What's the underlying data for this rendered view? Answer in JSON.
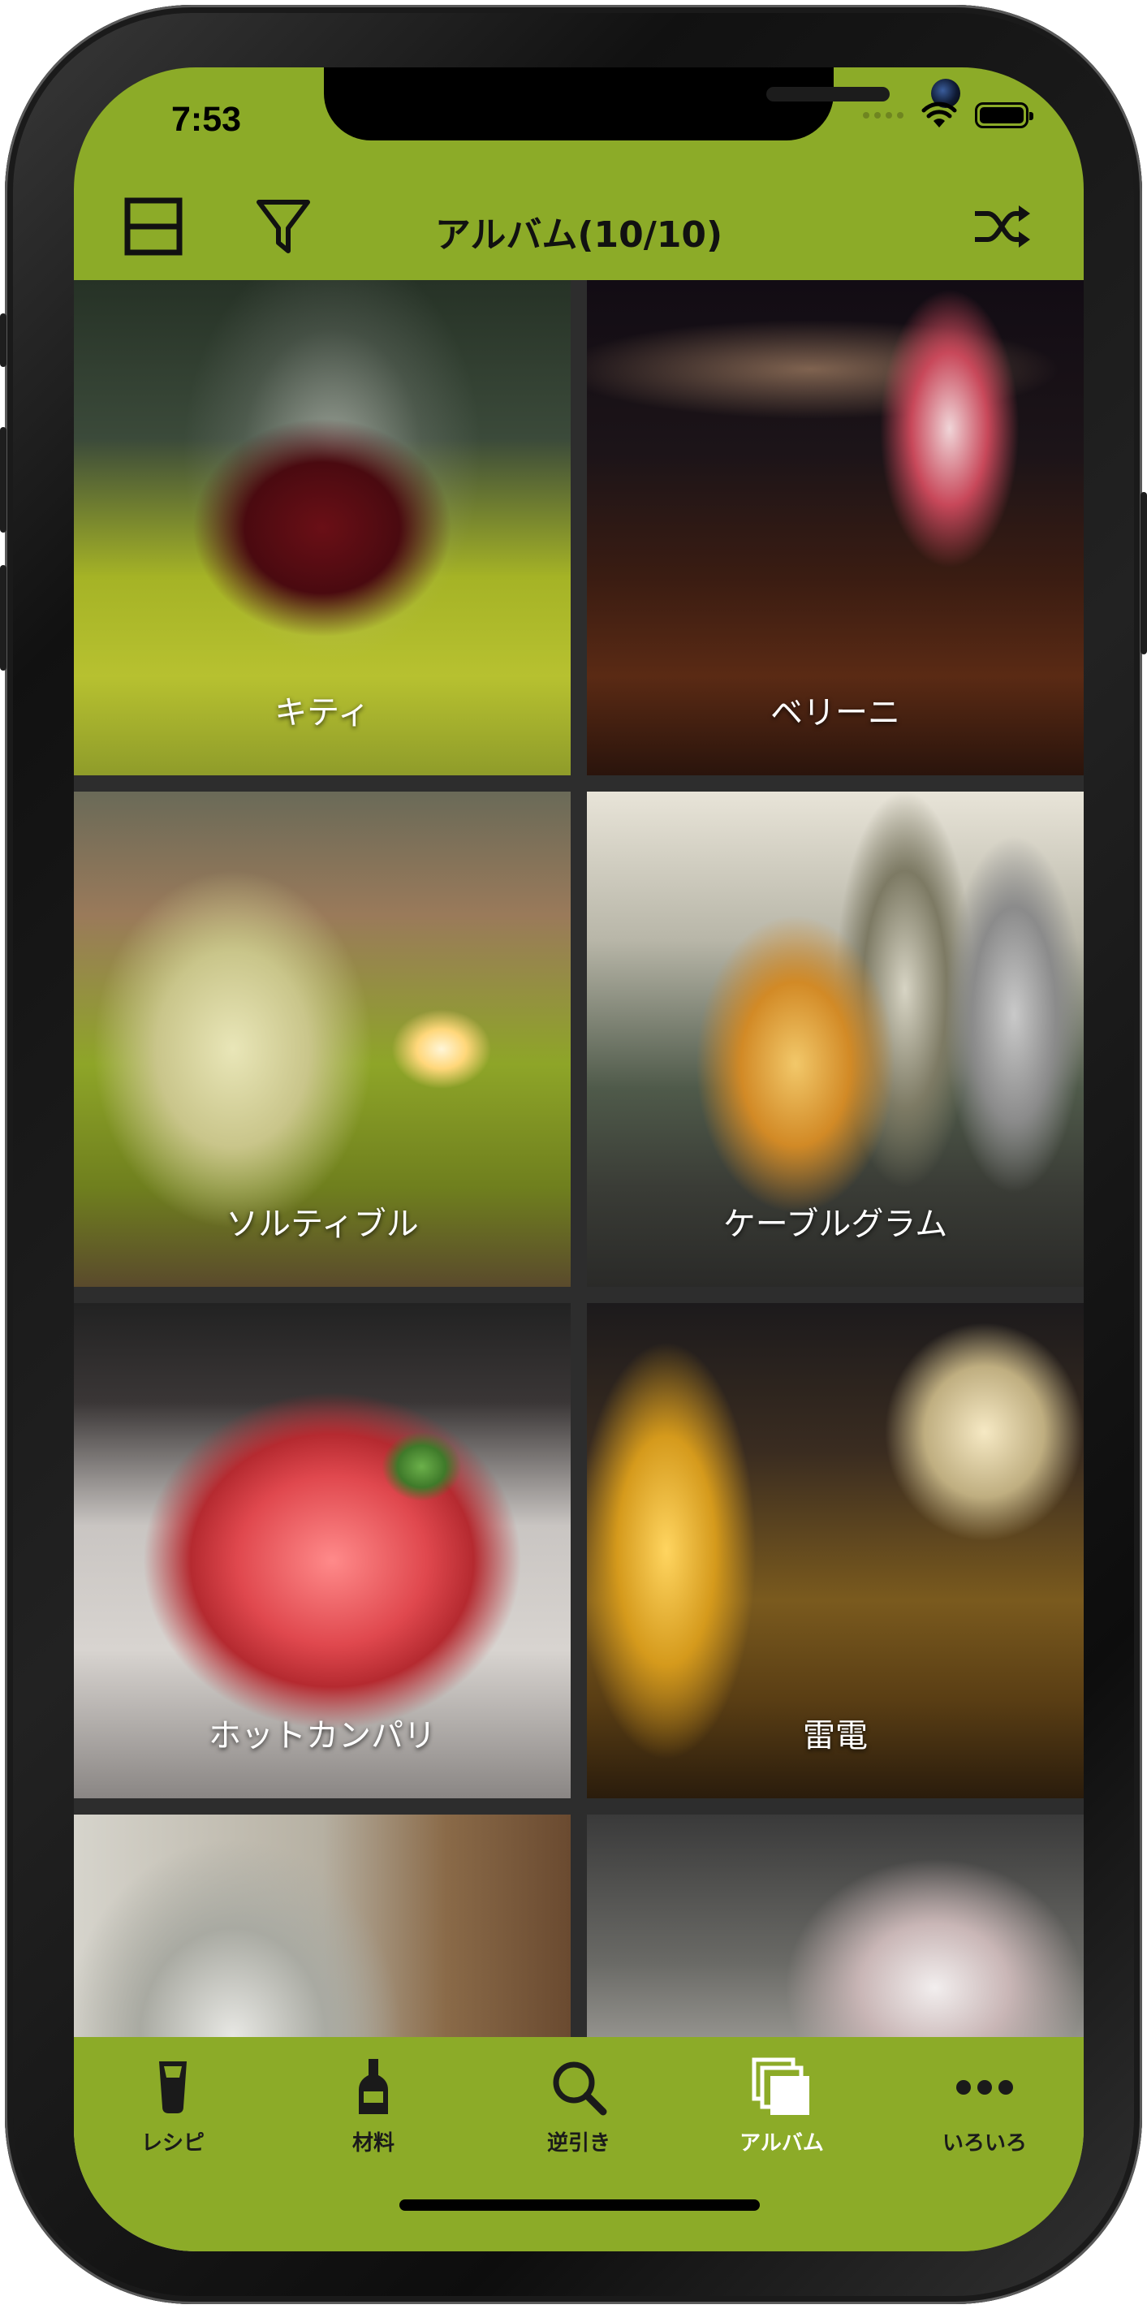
{
  "status_bar": {
    "time": "7:53"
  },
  "header": {
    "title": "アルバム(10/10)",
    "left_icons": [
      "layout-toggle-icon",
      "filter-icon"
    ],
    "right_icon": "shuffle-icon"
  },
  "album": {
    "items": [
      {
        "label": "キティ"
      },
      {
        "label": "ベリーニ"
      },
      {
        "label": "ソルティブル"
      },
      {
        "label": "ケーブルグラム"
      },
      {
        "label": "ホットカンパリ"
      },
      {
        "label": "雷電"
      },
      {
        "label": ""
      },
      {
        "label": ""
      }
    ]
  },
  "tabbar": {
    "active": "アルバム",
    "tabs": [
      {
        "label": "レシピ",
        "icon": "beer-glass-icon"
      },
      {
        "label": "材料",
        "icon": "bottle-icon"
      },
      {
        "label": "逆引き",
        "icon": "search-icon"
      },
      {
        "label": "アルバム",
        "icon": "album-icon"
      },
      {
        "label": "いろいろ",
        "icon": "more-icon"
      }
    ]
  },
  "colors": {
    "accent_green": "#8cab28",
    "active_tab_text": "#ffffff",
    "inactive_tab_text": "#1a1a1a"
  }
}
